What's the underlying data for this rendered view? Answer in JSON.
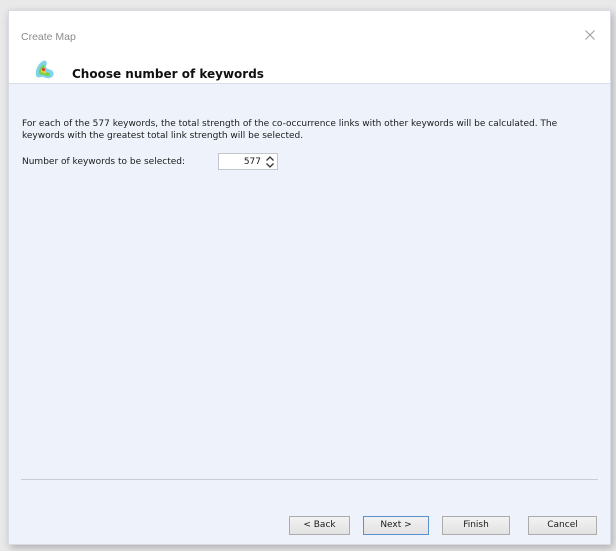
{
  "window": {
    "title": "Create Map"
  },
  "header": {
    "title": "Choose number of keywords"
  },
  "content": {
    "description": "For each of the 577 keywords, the total strength of the co-occurrence links with other keywords will be calculated. The keywords with the greatest total link strength will be selected.",
    "field_label": "Number of keywords to be selected:",
    "field_value": "577"
  },
  "buttons": {
    "back": "< Back",
    "next": "Next >",
    "finish": "Finish",
    "cancel": "Cancel"
  },
  "icons": {
    "close": "close-icon",
    "app": "vosviewer-icon",
    "spin_up": "chevron-up-icon",
    "spin_down": "chevron-down-icon"
  },
  "colors": {
    "content_bg": "#eef3fb",
    "header_bg": "#ffffff",
    "default_button_border": "#5a8fd0"
  }
}
